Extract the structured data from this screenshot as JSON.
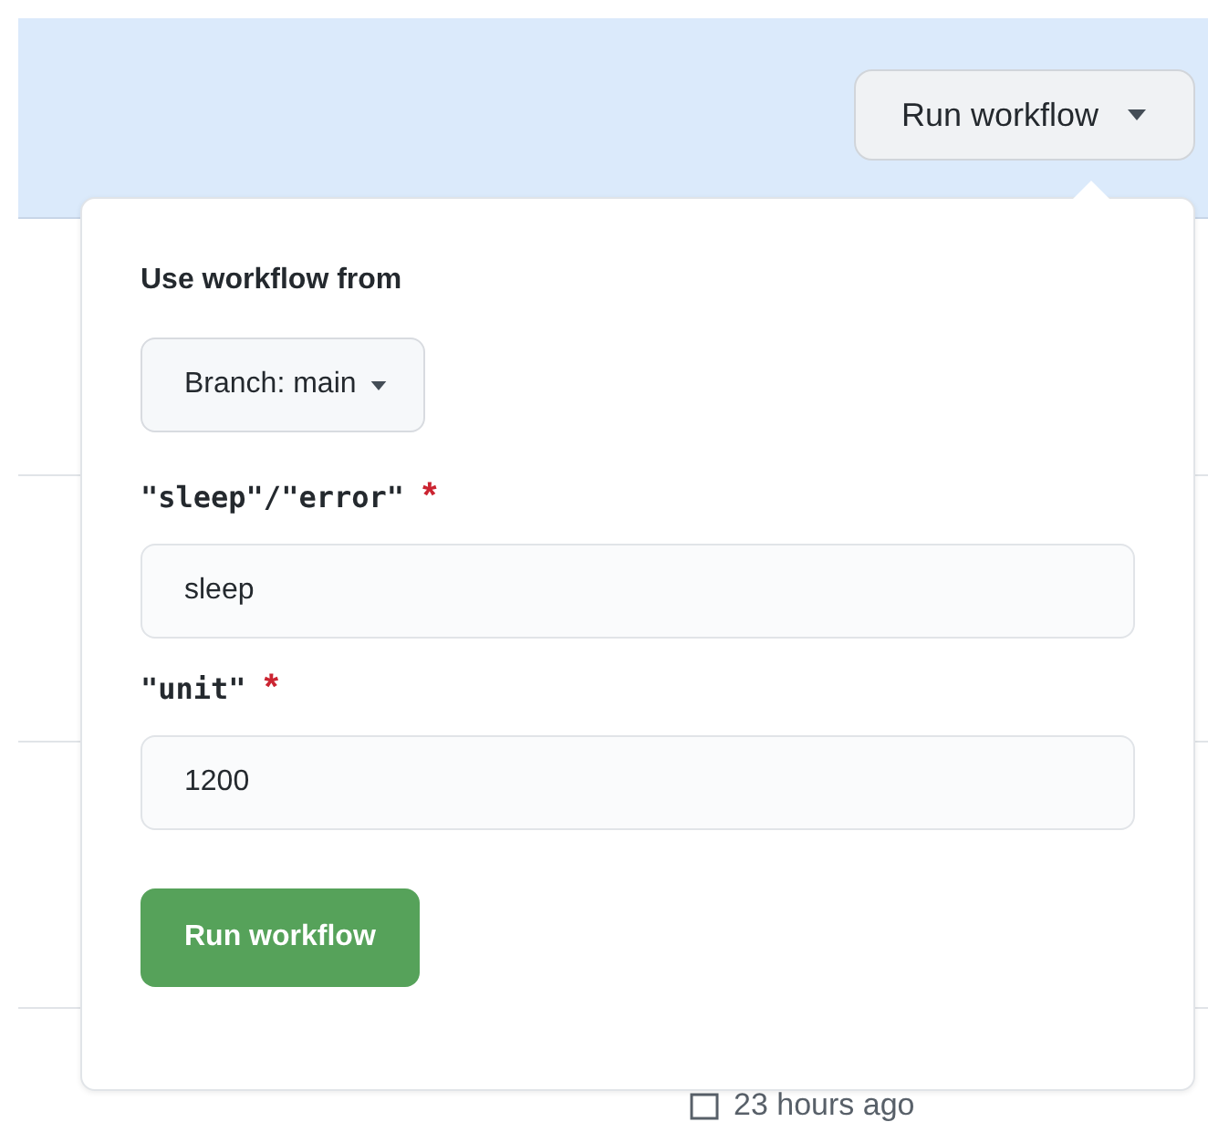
{
  "header": {
    "button": "Run workflow"
  },
  "popup": {
    "heading": "Use workflow from",
    "branch_button": "Branch: main",
    "inputs": [
      {
        "label": "\"sleep\"/\"error\"",
        "required_mark": "*",
        "value": "sleep"
      },
      {
        "label": "\"unit\"",
        "required_mark": "*",
        "value": "1200"
      }
    ],
    "submit": "Run workflow"
  },
  "background_row": {
    "time": "23 hours ago"
  }
}
